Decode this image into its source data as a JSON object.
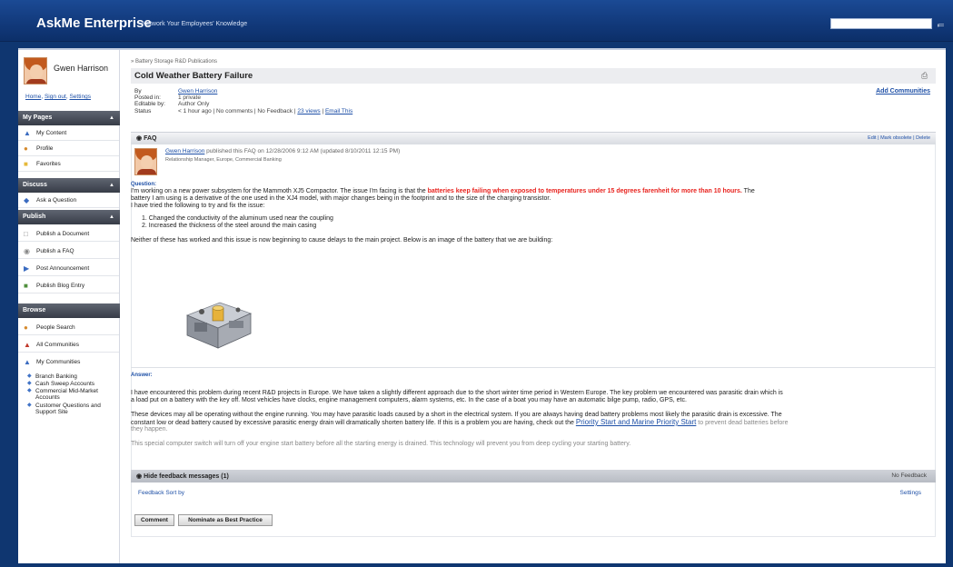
{
  "header": {
    "brand": "AskMe Enterprise",
    "tagline": "Network Your Employees' Knowledge",
    "search_placeholder": "",
    "search_icon": "search-arrow-icon"
  },
  "sidebar": {
    "user_name": "Gwen Harrison",
    "links": [
      "Home",
      "Sign out",
      "Settings"
    ],
    "my_pages": {
      "title": "My Pages",
      "items": [
        "My Content",
        "Profile",
        "Favorites"
      ]
    },
    "discuss": {
      "title": "Discuss",
      "items": [
        "Ask a Question"
      ]
    },
    "publish": {
      "title": "Publish",
      "items": [
        "Publish a Document",
        "Publish a FAQ",
        "Post Announcement",
        "Publish Blog Entry"
      ]
    },
    "browse": {
      "title": "Browse",
      "items": [
        "People Search",
        "All Communities",
        "My Communities"
      ]
    },
    "communities": [
      "Branch Banking",
      "Cash Sweep Accounts",
      "Commercial Mid-Market Accounts",
      "Customer Questions and Support Site"
    ]
  },
  "content": {
    "breadcrumb": "» Battery Storage R&D Publications",
    "title": "Cold Weather Battery Failure",
    "add_communities": "Add Communities",
    "meta": {
      "by_label": "By",
      "by_value": "Gwen Harrison",
      "posted_label": "Posted in:",
      "posted_value": "1 private",
      "editable_label": "Editable by:",
      "editable_value": "Author Only",
      "status_label": "Status",
      "status_value": "< 1 hour ago | No comments | No Feedback |",
      "views": "23 views",
      "email": "Email This",
      "sep": " | "
    },
    "faq": {
      "label": "FAQ",
      "actions": "Edit | Mark obsolete | Delete",
      "author": "Gwen Harrison",
      "published_text": " published this FAQ on 12/28/2006 9:12 AM (updated 8/10/2011 12:15 PM)",
      "role": "Relationship Manager, Europe, Commercial Banking"
    },
    "question": {
      "label": "Question:",
      "line1_a": "I'm working on a new power subsystem for the Mammoth XJ5 Compactor.  The issue I'm facing is that the ",
      "line1_red": "batteries keep failing when exposed to temperatures under 15 degrees farenheit for more than 10 hours.",
      "line1_b": "  The",
      "line2": "battery I am using is a derivative of the one used in the XJ4 model, with major changes being in the footprint and to the size of the charging transistor.",
      "line3": "I have tried the following to try and fix the issue:",
      "list": [
        "1.  Changed the conductivity of the aluminum used near the coupling",
        "2.  Increased the thickness of the steel around the main casing"
      ],
      "line4": "Neither of these has worked and this issue is now beginning to cause delays to the main project.  Below is an image of the battery that we are building:"
    },
    "answer": {
      "label": "Answer:",
      "p1_l1": "I have encountered this problem during recent R&D projects in Europe. We have taken a slightly different approach due to the short winter time period in Western Europe. The key problem we encountered was parasitic drain which is",
      "p1_l2": "a load put on a battery with the key off. Most vehicles have clocks, engine management computers, alarm systems, etc. In the case of a boat you may have an automatic bilge pump, radio, GPS, etc.",
      "p2_l1": "These devices may all be operating without the engine running. You may have parasitic loads caused by a short in the electrical system. If you are always having dead battery problems most likely the parasitic drain is excessive. The",
      "p2_l2": "constant low or dead battery caused by excessive parasitic energy drain will dramatically shorten battery life. If this is a problem you are having, check out the ",
      "p2_link": "Priority Start and Marine Priority Start",
      "p2_l2b": " to prevent dead batteries before",
      "p2_l3": "they happen.",
      "p3": "This special computer switch will turn off your engine start battery before all the starting energy is drained. This technology will prevent you from deep cycling your starting battery."
    },
    "feedback": {
      "label": "Hide feedback messages (1)",
      "no_feedback": "No Feedback",
      "links": "Feedback  Sort by",
      "settings": "Settings"
    },
    "buttons": {
      "comment": "Comment",
      "nominate": "Nominate as Best Practice"
    }
  }
}
